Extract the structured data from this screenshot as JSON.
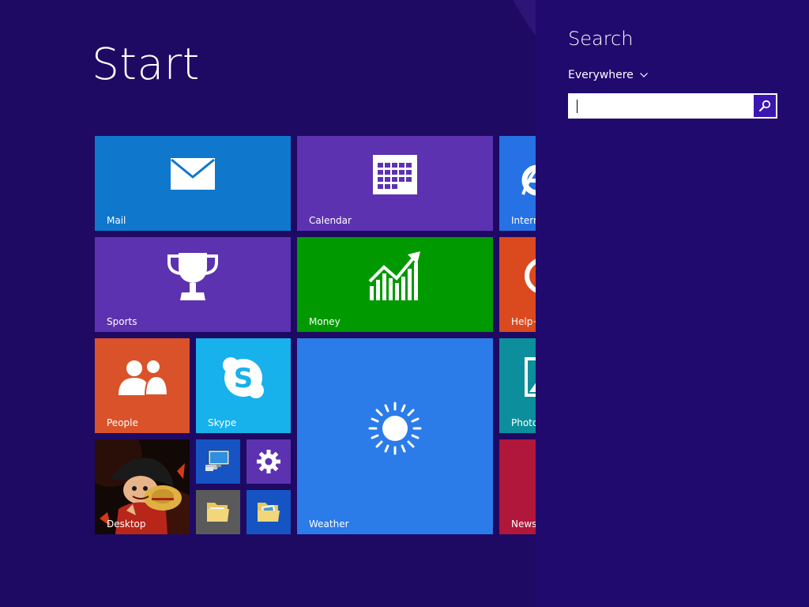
{
  "start": {
    "title": "Start"
  },
  "tiles": {
    "mail": {
      "label": "Mail",
      "color": "#0f77cc",
      "icon": "mail-icon"
    },
    "calendar": {
      "label": "Calendar",
      "color": "#5d32b0",
      "icon": "calendar-icon"
    },
    "internet_explorer": {
      "label": "Interne",
      "color": "#2671e4",
      "icon": "internet-explorer-icon"
    },
    "sports": {
      "label": "Sports",
      "color": "#5d32b0",
      "icon": "trophy-icon"
    },
    "money": {
      "label": "Money",
      "color": "#009a00",
      "icon": "stock-chart-icon"
    },
    "help": {
      "label": "Help+",
      "color": "#db4a1e",
      "icon": "help-icon"
    },
    "people": {
      "label": "People",
      "color": "#d9522a",
      "icon": "people-icon"
    },
    "skype": {
      "label": "Skype",
      "color": "#17b1eb",
      "icon": "skype-icon"
    },
    "weather": {
      "label": "Weather",
      "color": "#2b7be9",
      "icon": "sun-icon"
    },
    "photos": {
      "label": "Photo",
      "color": "#0d8e9c",
      "icon": "photo-icon"
    },
    "desktop": {
      "label": "Desktop",
      "color": "#000000",
      "icon": "desktop-wallpaper-image"
    },
    "this_pc": {
      "color": "#1554c2",
      "icon": "computer-icon"
    },
    "settings": {
      "color": "#5d32b0",
      "icon": "gear-icon"
    },
    "file_explorer": {
      "color": "#5a5a5a",
      "icon": "folder-icon"
    },
    "pictures": {
      "color": "#1554c2",
      "icon": "pictures-folder-icon"
    },
    "news": {
      "label": "News",
      "color": "#b0173a",
      "icon": "news-icon"
    }
  },
  "search_pane": {
    "title": "Search",
    "scope": "Everywhere",
    "query": "",
    "placeholder": "",
    "accent": "#3a16b3"
  },
  "colors": {
    "background": "#1e0a63",
    "pane_background": "#210a6e"
  }
}
